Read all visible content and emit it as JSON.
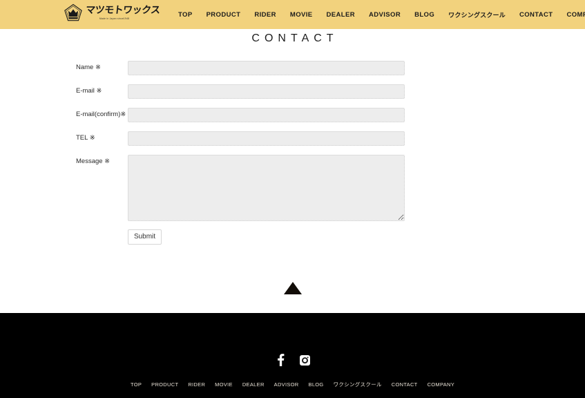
{
  "theme": {
    "header_bg": "#f2d27d",
    "footer_bg": "#000000",
    "page_bg": "#ffffff",
    "input_bg": "#ededed",
    "text_color": "#1d1d1d",
    "footer_link_color": "#e8e1d6"
  },
  "header": {
    "logo": {
      "brand_kana": "マツモトワックス",
      "tagline": "Made in Japan since1948",
      "mark": "crown-pentagon-emblem"
    },
    "nav": [
      {
        "label": "TOP",
        "jp": false
      },
      {
        "label": "PRODUCT",
        "jp": false
      },
      {
        "label": "RIDER",
        "jp": false
      },
      {
        "label": "MOVIE",
        "jp": false
      },
      {
        "label": "DEALER",
        "jp": false
      },
      {
        "label": "ADVISOR",
        "jp": false
      },
      {
        "label": "BLOG",
        "jp": false
      },
      {
        "label": "ワクシングスクール",
        "jp": true
      },
      {
        "label": "CONTACT",
        "jp": false
      },
      {
        "label": "COMPANY",
        "jp": false
      }
    ]
  },
  "main": {
    "title": "CONTACT",
    "form": {
      "fields": [
        {
          "label": "Name ※",
          "value": "",
          "placeholder": "",
          "type": "text",
          "name": "name"
        },
        {
          "label": "E-mail ※",
          "value": "",
          "placeholder": "",
          "type": "text",
          "name": "email"
        },
        {
          "label": "E-mail(confirm)※",
          "value": "",
          "placeholder": "",
          "type": "text",
          "name": "email-confirm"
        },
        {
          "label": "TEL ※",
          "value": "",
          "placeholder": "",
          "type": "text",
          "name": "tel"
        },
        {
          "label": "Message ※",
          "value": "",
          "placeholder": "",
          "type": "textarea",
          "name": "message"
        }
      ],
      "submit_label": "Submit"
    },
    "scroll_top_icon": "triangle-up-icon"
  },
  "footer": {
    "social": [
      {
        "name": "facebook-icon",
        "label": "f"
      },
      {
        "name": "instagram-icon",
        "label": ""
      }
    ],
    "nav": [
      {
        "label": "TOP",
        "jp": false
      },
      {
        "label": "PRODUCT",
        "jp": false
      },
      {
        "label": "RIDER",
        "jp": false
      },
      {
        "label": "MOVIE",
        "jp": false
      },
      {
        "label": "DEALER",
        "jp": false
      },
      {
        "label": "ADVISOR",
        "jp": false
      },
      {
        "label": "BLOG",
        "jp": false
      },
      {
        "label": "ワクシングスクール",
        "jp": true
      },
      {
        "label": "CONTACT",
        "jp": false
      },
      {
        "label": "COMPANY",
        "jp": false
      }
    ]
  }
}
